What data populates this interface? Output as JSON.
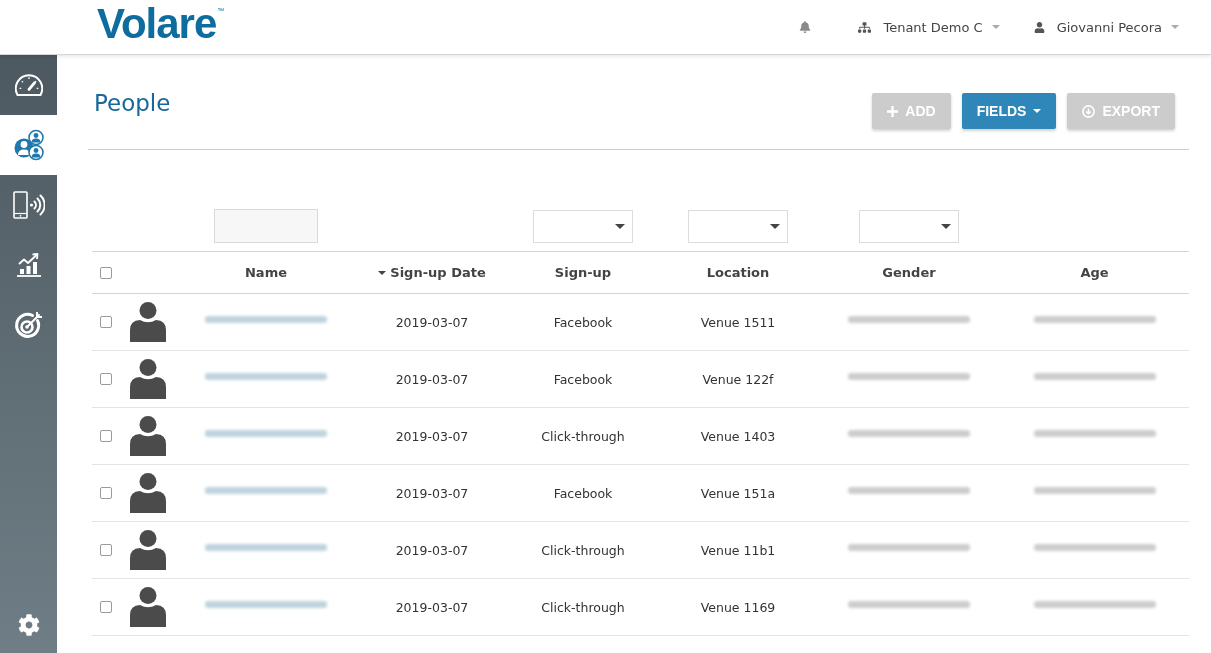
{
  "header": {
    "logo": "Volare",
    "logo_mark": "™",
    "tenant_menu": {
      "label": "Tenant Demo C"
    },
    "user_menu": {
      "label": "Giovanni Pecora"
    }
  },
  "sidebar": {
    "items": [
      {
        "selected": false
      },
      {
        "selected": true
      },
      {
        "selected": false
      },
      {
        "selected": false
      },
      {
        "selected": false
      }
    ]
  },
  "page": {
    "title": "People",
    "buttons": [
      {
        "label": "ADD",
        "kind": "add",
        "disabled": true
      },
      {
        "label": "FIELDS",
        "kind": "menu",
        "disabled": false
      },
      {
        "label": "EXPORT",
        "kind": "export",
        "disabled": true
      }
    ]
  },
  "table": {
    "select_all": {
      "checked": false
    },
    "columns": [
      {
        "label": "Name",
        "kind": "hiddenlink",
        "filter": {
          "kind": "text"
        }
      },
      {
        "label": "Sign-up Date",
        "kind": "text",
        "sorted": true,
        "descending": true
      },
      {
        "label": "Sign-up",
        "kind": "text",
        "filter": {
          "kind": "select"
        }
      },
      {
        "label": "Location",
        "kind": "text",
        "filter": {
          "kind": "select"
        }
      },
      {
        "label": "Gender",
        "kind": "hidden",
        "filter": {
          "kind": "select"
        }
      },
      {
        "label": "Age",
        "kind": "hidden"
      }
    ],
    "rows": [
      {
        "checked": false,
        "values": [
          "2019-03-07",
          "Facebook",
          "Venue 1511"
        ]
      },
      {
        "checked": false,
        "values": [
          "2019-03-07",
          "Facebook",
          "Venue 122f"
        ]
      },
      {
        "checked": false,
        "values": [
          "2019-03-07",
          "Click-through",
          "Venue 1403"
        ]
      },
      {
        "checked": false,
        "values": [
          "2019-03-07",
          "Facebook",
          "Venue 151a"
        ]
      },
      {
        "checked": false,
        "values": [
          "2019-03-07",
          "Click-through",
          "Venue 11b1"
        ]
      },
      {
        "checked": false,
        "values": [
          "2019-03-07",
          "Click-through",
          "Venue 1169"
        ]
      }
    ]
  }
}
